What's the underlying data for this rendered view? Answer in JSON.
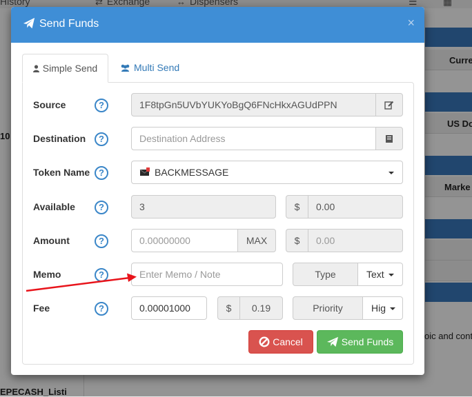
{
  "background": {
    "nav": {
      "history": "History",
      "exchange": "Exchange",
      "dispensers": "Dispensers"
    },
    "right_headers": [
      "Curre",
      "US Do",
      "Marke"
    ],
    "left_number": "10",
    "bottom_left": "EPECASH_Listi",
    "right_snippet": "oic and cont"
  },
  "modal": {
    "title": "Send Funds",
    "close": "×",
    "tabs": {
      "simple": "Simple Send",
      "multi": "Multi Send"
    },
    "source": {
      "label": "Source",
      "value": "1F8tpGn5UVbYUKYoBgQ6FNcHkxAGUdPPN"
    },
    "destination": {
      "label": "Destination",
      "placeholder": "Destination Address"
    },
    "token": {
      "label": "Token Name",
      "value": "BACKMESSAGE"
    },
    "available": {
      "label": "Available",
      "value": "3",
      "usd_symbol": "$",
      "usd_value": "0.00"
    },
    "amount": {
      "label": "Amount",
      "placeholder": "0.00000000",
      "max_label": "MAX",
      "usd_symbol": "$",
      "usd_value": "0.00"
    },
    "memo": {
      "label": "Memo",
      "placeholder": "Enter Memo / Note",
      "type_label": "Type",
      "type_value": "Text"
    },
    "fee": {
      "label": "Fee",
      "value": "0.00001000",
      "usd_symbol": "$",
      "usd_value": "0.19",
      "priority_label": "Priority",
      "priority_value": "Hig"
    },
    "help": "?",
    "buttons": {
      "cancel": "Cancel",
      "send": "Send Funds"
    }
  },
  "colors": {
    "header": "#3f8ed6",
    "cancel": "#d9534f",
    "send": "#5cb85c",
    "arrow": "#e8141b"
  }
}
